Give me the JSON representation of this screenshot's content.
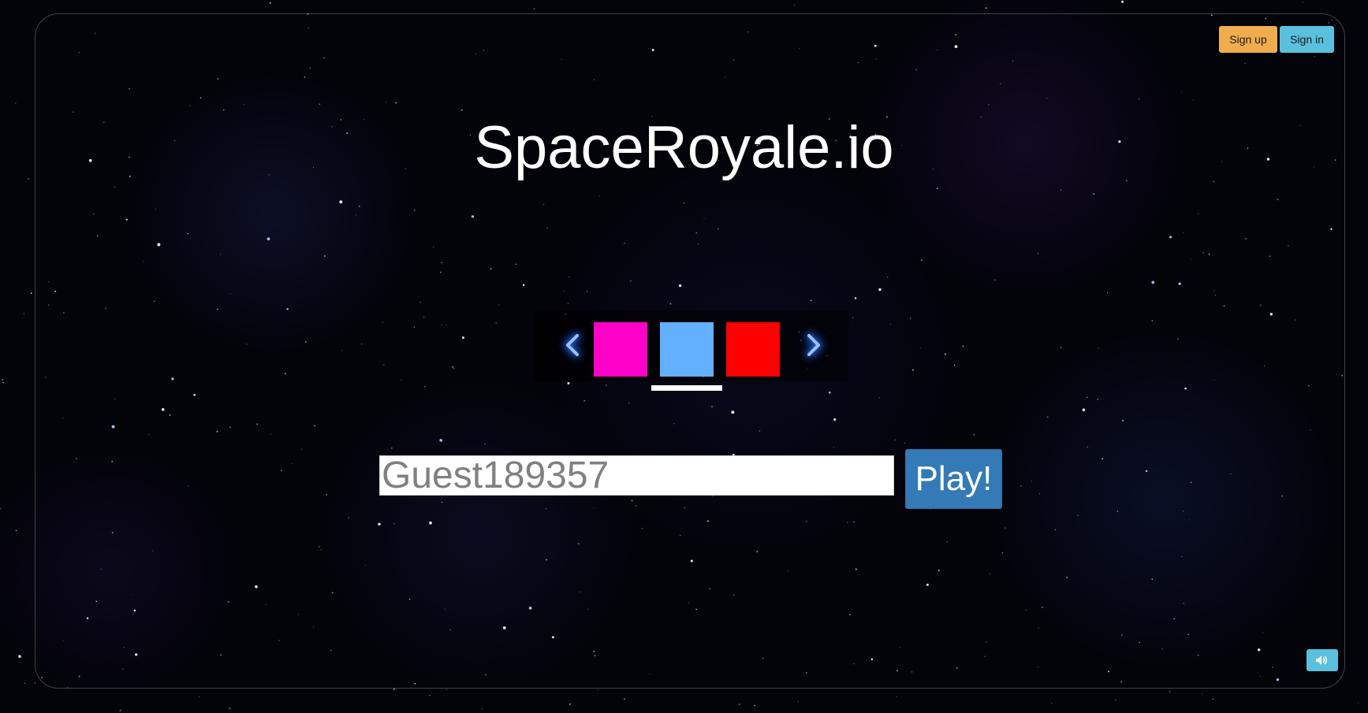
{
  "header": {
    "signup_label": "Sign up",
    "signin_label": "Sign in"
  },
  "title": "SpaceRoyale.io",
  "skin_picker": {
    "prev_icon": "chevron-left-icon",
    "next_icon": "chevron-right-icon",
    "skins": [
      {
        "color": "#ff00c8"
      },
      {
        "color": "#62b0ff"
      },
      {
        "color": "#ff0000"
      }
    ],
    "selected_index": 1
  },
  "name_input": {
    "placeholder": "Guest189357",
    "value": ""
  },
  "play_label": "Play!",
  "sound_icon": "volume-icon",
  "colors": {
    "signup": "#f0ad4e",
    "signin": "#5bc0de",
    "play": "#337ab7"
  }
}
